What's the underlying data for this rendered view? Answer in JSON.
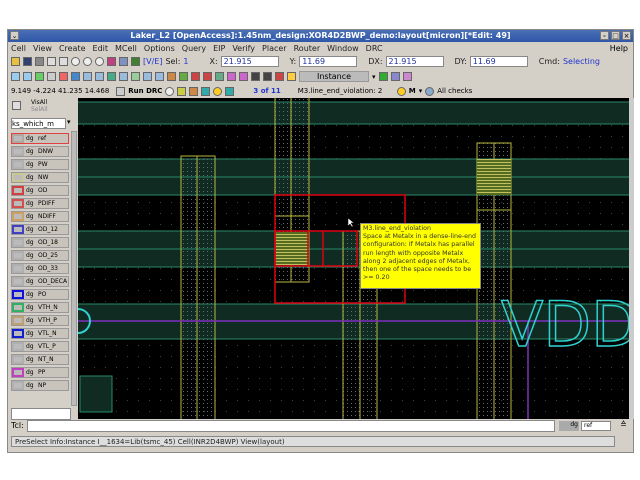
{
  "window": {
    "title": "Laker_L2 [OpenAccess]:1.45nm_design:XOR4D2BWP_demo:layout[micron][*Edit: 49]"
  },
  "menu": [
    "Cell",
    "View",
    "Create",
    "Edit",
    "MCell",
    "Options",
    "Query",
    "EIP",
    "Verify",
    "Placer",
    "Router",
    "Window",
    "DRC"
  ],
  "help": "Help",
  "toolbar1": {
    "mode": "[V/E]",
    "sel_label": "Sel:",
    "sel": "1",
    "x_label": "X:",
    "x": "21.915",
    "y_label": "Y:",
    "y": "11.69",
    "dx_label": "DX:",
    "dx": "21.915",
    "dy_label": "DY:",
    "dy": "11.69",
    "cmd_label": "Cmd:",
    "cmd": "Selecting"
  },
  "toolbar2": {
    "instance": "Instance"
  },
  "toolbar3": {
    "coords": "9.149 -4.224 41.235 14.468",
    "run_drc": "Run DRC",
    "count": "3 of 11",
    "violation": "M3.line_end_violation: 2",
    "m": "M",
    "checks": "All checks"
  },
  "panel": {
    "visi": "VisAll",
    "sele": "SelAll",
    "filter": "ks_which_m",
    "layers": [
      {
        "dg": "dg",
        "name": "ref",
        "color": "#b0a8a0"
      },
      {
        "dg": "dg",
        "name": "DNW",
        "color": "#b0b0b0"
      },
      {
        "dg": "dg",
        "name": "PW",
        "color": "#b0b0b0"
      },
      {
        "dg": "dg",
        "name": "NW",
        "color": "#c8c890"
      },
      {
        "dg": "dg",
        "name": "OD",
        "color": "#d04040"
      },
      {
        "dg": "dg",
        "name": "PDIFF",
        "color": "#d05050"
      },
      {
        "dg": "dg",
        "name": "NDIFF",
        "color": "#d0a060"
      },
      {
        "dg": "dg",
        "name": "OD_12",
        "color": "#4040c0"
      },
      {
        "dg": "dg",
        "name": "OD_18",
        "color": "#b0b0b0"
      },
      {
        "dg": "dg",
        "name": "OD_25",
        "color": "#b0b0b0"
      },
      {
        "dg": "dg",
        "name": "OD_33",
        "color": "#b0b0b0"
      },
      {
        "dg": "dg",
        "name": "OD_DECA",
        "color": "#b0b0b0"
      },
      {
        "dg": "dg",
        "name": "PO",
        "color": "#1010e0"
      },
      {
        "dg": "dg",
        "name": "VTH_N",
        "color": "#30b060"
      },
      {
        "dg": "dg",
        "name": "VTH_P",
        "color": "#c0a070"
      },
      {
        "dg": "dg",
        "name": "VTL_N",
        "color": "#1020d0"
      },
      {
        "dg": "dg",
        "name": "VTL_P",
        "color": "#b0b0b0"
      },
      {
        "dg": "dg",
        "name": "NT_N",
        "color": "#b0b0b0"
      },
      {
        "dg": "dg",
        "name": "PP",
        "color": "#c040c0"
      },
      {
        "dg": "dg",
        "name": "NP",
        "color": "#b0b0b0"
      }
    ]
  },
  "canvas": {
    "label": "VDD",
    "tooltip": [
      "M3.line_end_violation",
      "Space at Metalx in a dense-line-end",
      "configuration: If Metalx has parallel",
      "run length with opposite Metalx",
      "along 2 adjacent edges of Metalx,",
      "then one of the space needs to be",
      ">= 0.20"
    ]
  },
  "tcl": {
    "label": "Tcl:",
    "value": "",
    "dg": "dg",
    "layer": "ref"
  },
  "status": "PreSelect Info:Instance I__1634=Lib(tsmc_45) Cell(INR2D4BWP) View(layout)"
}
